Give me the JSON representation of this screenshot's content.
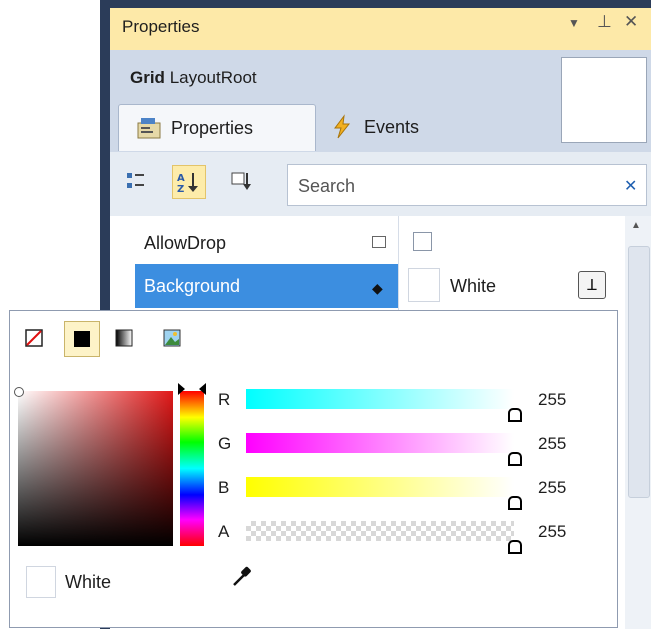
{
  "window": {
    "title": "Properties",
    "title_icons": [
      "dropdown-arrow-icon",
      "pin-icon",
      "close-icon"
    ],
    "object_type": "Grid",
    "object_name": "LayoutRoot"
  },
  "tabs": [
    {
      "label": "Properties",
      "icon": "properties-icon",
      "selected": true
    },
    {
      "label": "Events",
      "icon": "lightning-icon",
      "selected": false
    }
  ],
  "toolbar": {
    "buttons": [
      "categorize-icon",
      "sort-alphabetical-icon",
      "filter-icon"
    ],
    "search_placeholder": "Search"
  },
  "properties": [
    {
      "name": "AllowDrop",
      "value": "",
      "checkbox": false
    },
    {
      "name": "Background",
      "value": "White",
      "selected": true
    }
  ],
  "color_editor": {
    "brush_types": [
      "no-brush-icon",
      "solid-brush-icon",
      "gradient-brush-icon",
      "image-brush-icon"
    ],
    "channels": [
      {
        "label": "R",
        "value": "255"
      },
      {
        "label": "G",
        "value": "255"
      },
      {
        "label": "B",
        "value": "255"
      },
      {
        "label": "A",
        "value": "255"
      }
    ],
    "current_color_name": "White",
    "colors": {
      "selection": "#3c8ee0",
      "titlebar": "#fde9a8",
      "frame": "#2b3c59"
    }
  }
}
